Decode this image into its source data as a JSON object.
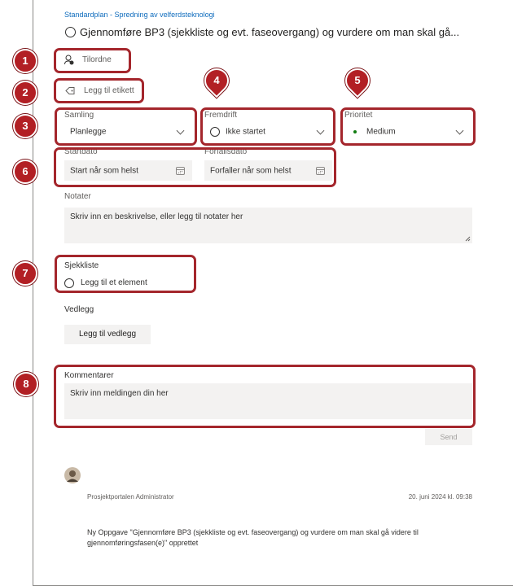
{
  "header": {
    "breadcrumb": "Standardplan - Spredning av velferdsteknologi",
    "title": "Gjennomføre BP3 (sjekkliste og evt. faseovergang) og vurdere om man skal gå..."
  },
  "assign": {
    "label": "Tilordne"
  },
  "tag": {
    "label": "Legg til etikett"
  },
  "bucket": {
    "label": "Samling",
    "value": "Planlegge"
  },
  "progress": {
    "label": "Fremdrift",
    "value": "Ikke startet"
  },
  "priority": {
    "label": "Prioritet",
    "value": "Medium",
    "dot_color": "#107c10"
  },
  "start_date": {
    "label": "Startdato",
    "value": "Start når som helst"
  },
  "due_date": {
    "label": "Forfallsdato",
    "value": "Forfaller når som helst"
  },
  "notes": {
    "label": "Notater",
    "placeholder": "Skriv inn en beskrivelse, eller legg til notater her"
  },
  "checklist": {
    "label": "Sjekkliste",
    "add_item": "Legg til et element"
  },
  "attachments": {
    "label": "Vedlegg",
    "button": "Legg til vedlegg"
  },
  "comments": {
    "label": "Kommentarer",
    "placeholder": "Skriv inn meldingen din her",
    "send": "Send",
    "entries": [
      {
        "author": "Prosjektportalen Administrator",
        "timestamp": "20. juni 2024 kl. 09:38",
        "text": "Ny Oppgave \"Gjennomføre BP3 (sjekkliste og evt. faseovergang) og vurdere om man skal gå videre til gjennomføringsfasen(e)\" opprettet"
      }
    ]
  },
  "annotations": {
    "accent": "#b21f24",
    "markers": [
      "1",
      "2",
      "3",
      "4",
      "5",
      "6",
      "7",
      "8"
    ]
  }
}
